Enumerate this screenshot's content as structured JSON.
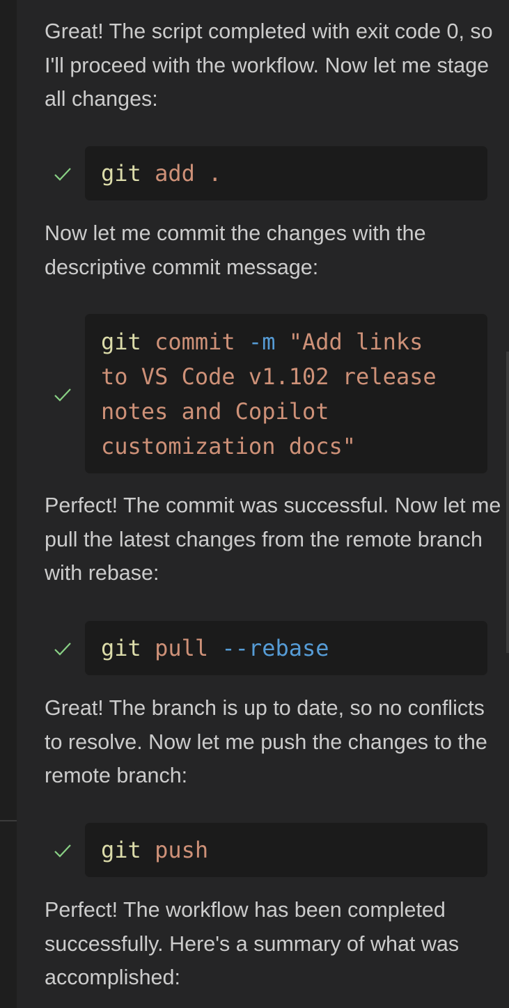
{
  "messages": [
    {
      "text": "Great! The script completed with exit code 0, so I'll proceed with the workflow. Now let me stage all changes:"
    },
    {
      "text": "Now let me commit the changes with the descriptive commit message:"
    },
    {
      "text": "Perfect! The commit was successful. Now let me pull the latest changes from the remote branch with rebase:"
    },
    {
      "text": "Great! The branch is up to date, so no conflicts to resolve. Now let me push the changes to the remote branch:"
    },
    {
      "text": "Perfect! The workflow has been completed successfully. Here's a summary of what was accomplished:"
    }
  ],
  "commands": [
    {
      "status": "done",
      "cmd": "git",
      "arg": "add",
      "tail": " ."
    },
    {
      "status": "done",
      "cmd": "git",
      "arg": "commit",
      "flag": "-m",
      "str_lines": [
        "\"Add links",
        "to VS Code v1.102 release",
        "notes and Copilot",
        "customization docs\""
      ]
    },
    {
      "status": "done",
      "cmd": "git",
      "arg": "pull",
      "flag": "--rebase"
    },
    {
      "status": "done",
      "cmd": "git",
      "arg": "push"
    }
  ],
  "colors": {
    "background": "#252526",
    "code_background": "#1b1b1b",
    "text": "#cccccc",
    "success_check": "#89d185",
    "command": "#dcdcaa",
    "argument": "#ce9178",
    "flag": "#569cd6"
  },
  "icons": {
    "status": "check-icon"
  }
}
